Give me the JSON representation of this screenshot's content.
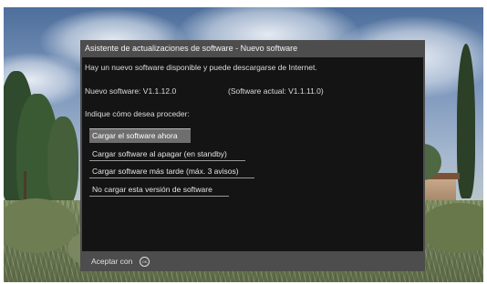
{
  "dialog": {
    "title": "Asistente de actualizaciones de software - Nuevo software",
    "message": "Hay un nuevo software disponible y puede descargarse de Internet.",
    "new_software_label": "Nuevo software:  V1.1.12.0",
    "current_software_label": "(Software actual:  V1.1.11.0)",
    "prompt": "Indique cómo desea proceder:",
    "options": [
      {
        "label": "Cargar el software ahora",
        "selected": true
      },
      {
        "label": "Cargar software al apagar (en standby)",
        "selected": false
      },
      {
        "label": "Cargar software más tarde (máx. 3 avisos)",
        "selected": false
      },
      {
        "label": "No cargar esta versión de software",
        "selected": false
      }
    ],
    "footer": {
      "accept_label": "Aceptar con",
      "ok_icon": "ok-button-icon",
      "ok_icon_text": "OK"
    }
  },
  "colors": {
    "dialog_frame": "#4d4d4d",
    "dialog_body": "#141414",
    "selected_option": "#6e6e6e",
    "text": "#dcdcdc"
  }
}
